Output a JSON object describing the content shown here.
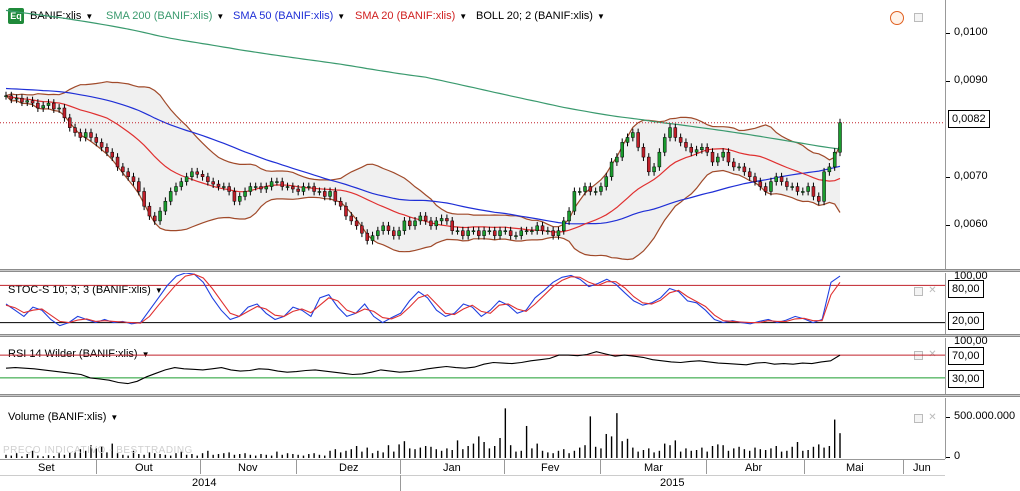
{
  "colors": {
    "price_up": "#1a9c2e",
    "price_down": "#c0202a",
    "sma200": "#3a9a6e",
    "sma50": "#1f2fd6",
    "sma20": "#e03030",
    "boll": "#a04a2a",
    "stoch_k": "#2040e0",
    "stoch_d": "#e03030",
    "level_line": "#c0202a",
    "oversold_line": "#1a9c2e"
  },
  "price_panel": {
    "logo": "Eq",
    "symbol": "BANIF:xlis",
    "sma200": "SMA 200 (BANIF:xlis)",
    "sma50": "SMA 50 (BANIF:xlis)",
    "sma20": "SMA 20 (BANIF:xlis)",
    "boll": "BOLL 20; 2 (BANIF:xlis)",
    "y_ticks": [
      "0,0100",
      "0,0090",
      "0,0070",
      "0,0060"
    ],
    "last_price": "0,0082"
  },
  "stoch_panel": {
    "title": "STOC-S 10; 3; 3 (BANIF:xlis)",
    "y_ticks": [
      "100,00"
    ],
    "levels": [
      "80,00",
      "20,00"
    ]
  },
  "rsi_panel": {
    "title": "RSI 14 Wilder (BANIF:xlis)",
    "y_ticks": [
      "100,00"
    ],
    "levels": [
      "70,00",
      "30,00"
    ]
  },
  "volume_panel": {
    "title": "Volume (BANIF:xlis)",
    "y_ticks": [
      "500.000.000",
      "0"
    ]
  },
  "x_axis": {
    "months": [
      "Set",
      "Out",
      "Nov",
      "Dez",
      "Jan",
      "Fev",
      "Mar",
      "Abr",
      "Mai",
      "Jun"
    ],
    "years": [
      "2014",
      "2015"
    ]
  },
  "watermark": "PREÇO INDICATIVO - BESTTRADING",
  "chart_data": [
    {
      "type": "candlestick",
      "title": "BANIF:xlis",
      "x_range": [
        "2014-09",
        "2015-06"
      ],
      "ylim": [
        0.0052,
        0.0107
      ],
      "close": [
        0.00875,
        0.00868,
        0.0087,
        0.00862,
        0.00865,
        0.0086,
        0.0085,
        0.00855,
        0.0086,
        0.00848,
        0.0085,
        0.0083,
        0.0081,
        0.008,
        0.0079,
        0.008,
        0.0079,
        0.0078,
        0.0077,
        0.0076,
        0.0075,
        0.0073,
        0.0072,
        0.0071,
        0.007,
        0.0068,
        0.0065,
        0.0063,
        0.0062,
        0.0064,
        0.0066,
        0.0068,
        0.0069,
        0.007,
        0.0071,
        0.0072,
        0.00715,
        0.0071,
        0.007,
        0.00695,
        0.0069,
        0.0069,
        0.0068,
        0.0066,
        0.0067,
        0.0068,
        0.0069,
        0.0069,
        0.00685,
        0.0069,
        0.007,
        0.007,
        0.0069,
        0.0069,
        0.00685,
        0.0068,
        0.0069,
        0.0069,
        0.0068,
        0.0068,
        0.0067,
        0.0068,
        0.0066,
        0.0065,
        0.0063,
        0.0062,
        0.0061,
        0.00595,
        0.0058,
        0.0059,
        0.006,
        0.0061,
        0.006,
        0.0059,
        0.006,
        0.0062,
        0.0061,
        0.0062,
        0.0063,
        0.0062,
        0.0061,
        0.0062,
        0.00625,
        0.0062,
        0.006,
        0.006,
        0.0059,
        0.006,
        0.006,
        0.0059,
        0.006,
        0.006,
        0.0059,
        0.006,
        0.006,
        0.0059,
        0.0059,
        0.006,
        0.006,
        0.006,
        0.0061,
        0.006,
        0.006,
        0.0059,
        0.006,
        0.0062,
        0.0064,
        0.0068,
        0.0068,
        0.0069,
        0.0068,
        0.0068,
        0.0069,
        0.0071,
        0.0074,
        0.0075,
        0.0078,
        0.0079,
        0.008,
        0.0077,
        0.0075,
        0.0072,
        0.0073,
        0.0076,
        0.0079,
        0.0081,
        0.0079,
        0.0078,
        0.0077,
        0.0076,
        0.00765,
        0.0077,
        0.0076,
        0.0074,
        0.0075,
        0.0076,
        0.0074,
        0.0073,
        0.0073,
        0.0072,
        0.0071,
        0.007,
        0.0069,
        0.0068,
        0.007,
        0.0071,
        0.007,
        0.0069,
        0.0069,
        0.0068,
        0.0068,
        0.0069,
        0.0067,
        0.0066,
        0.0072,
        0.0073,
        0.0076,
        0.0082
      ],
      "overlays": [
        "SMA 200",
        "SMA 50",
        "SMA 20",
        "BOLL 20; 2"
      ]
    },
    {
      "type": "line",
      "title": "STOC-S 10; 3; 3",
      "ylim": [
        0,
        100
      ],
      "series": [
        {
          "name": "%K",
          "values": [
            50,
            40,
            30,
            45,
            40,
            25,
            15,
            20,
            30,
            25,
            20,
            25,
            20,
            22,
            18,
            20,
            40,
            60,
            80,
            95,
            100,
            98,
            85,
            60,
            40,
            25,
            30,
            45,
            50,
            35,
            25,
            30,
            45,
            40,
            30,
            60,
            65,
            45,
            30,
            35,
            50,
            30,
            20,
            28,
            35,
            55,
            70,
            60,
            40,
            30,
            35,
            50,
            45,
            30,
            40,
            55,
            48,
            35,
            40,
            60,
            72,
            85,
            93,
            96,
            90,
            78,
            83,
            90,
            82,
            68,
            55,
            48,
            52,
            60,
            75,
            70,
            55,
            52,
            40,
            25,
            20,
            23,
            20,
            18,
            22,
            25,
            20,
            24,
            30,
            26,
            20,
            25,
            85,
            95
          ]
        },
        {
          "name": "%D",
          "values": [
            48,
            44,
            36,
            40,
            42,
            32,
            22,
            20,
            24,
            26,
            22,
            23,
            22,
            21,
            20,
            19,
            30,
            48,
            65,
            82,
            95,
            98,
            92,
            75,
            55,
            35,
            30,
            38,
            46,
            42,
            32,
            30,
            38,
            42,
            36,
            48,
            60,
            55,
            40,
            35,
            42,
            38,
            28,
            26,
            32,
            45,
            60,
            65,
            50,
            35,
            33,
            42,
            48,
            38,
            35,
            48,
            50,
            42,
            38,
            50,
            64,
            78,
            88,
            94,
            93,
            85,
            80,
            86,
            86,
            76,
            62,
            52,
            50,
            56,
            68,
            72,
            62,
            54,
            46,
            32,
            23,
            22,
            21,
            20,
            20,
            23,
            22,
            22,
            26,
            27,
            23,
            23,
            65,
            85
          ]
        }
      ],
      "levels": [
        80,
        20
      ]
    },
    {
      "type": "line",
      "title": "RSI 14 Wilder",
      "ylim": [
        0,
        100
      ],
      "series": [
        {
          "name": "RSI",
          "values": [
            47,
            48,
            47,
            46,
            44,
            42,
            40,
            38,
            36,
            30,
            28,
            26,
            22,
            20,
            24,
            32,
            38,
            44,
            48,
            46,
            45,
            44,
            46,
            48,
            44,
            42,
            43,
            46,
            45,
            42,
            40,
            41,
            43,
            44,
            42,
            40,
            38,
            36,
            37,
            40,
            44,
            42,
            40,
            41,
            43,
            46,
            48,
            50,
            48,
            47,
            49,
            54,
            57,
            56,
            55,
            57,
            60,
            62,
            64,
            70,
            70,
            69,
            71,
            76,
            72,
            68,
            70,
            68,
            66,
            62,
            60,
            58,
            57,
            59,
            60,
            58,
            56,
            55,
            54,
            53,
            56,
            57,
            54,
            55,
            54,
            56,
            55,
            58,
            60,
            70
          ]
        }
      ],
      "levels": [
        70,
        30
      ]
    },
    {
      "type": "bar",
      "title": "Volume",
      "ylim": [
        0,
        700000000
      ],
      "values": [
        40,
        30,
        60,
        20,
        50,
        90,
        30,
        20,
        35,
        25,
        60,
        40,
        70,
        80,
        110,
        90,
        160,
        120,
        150,
        70,
        180,
        60,
        40,
        30,
        90,
        50,
        40,
        70,
        60,
        50,
        40,
        30,
        60,
        80,
        40,
        50,
        30,
        60,
        90,
        40,
        50,
        60,
        70,
        40,
        50,
        60,
        40,
        30,
        50,
        40,
        30,
        80,
        40,
        60,
        50,
        40,
        30,
        50,
        60,
        40,
        30,
        90,
        110,
        70,
        90,
        110,
        150,
        80,
        130,
        60,
        90,
        70,
        160,
        80,
        170,
        210,
        120,
        110,
        130,
        150,
        140,
        110,
        90,
        120,
        100,
        220,
        110,
        150,
        180,
        270,
        200,
        120,
        150,
        250,
        620,
        160,
        80,
        90,
        400,
        120,
        180,
        90,
        70,
        60,
        90,
        110,
        60,
        90,
        130,
        160,
        520,
        140,
        120,
        300,
        270,
        560,
        210,
        240,
        130,
        80,
        100,
        120,
        70,
        90,
        180,
        160,
        220,
        80,
        120,
        90,
        100,
        130,
        80,
        150,
        170,
        160,
        90,
        120,
        140,
        110,
        90,
        130,
        110,
        100,
        120,
        150,
        80,
        90,
        140,
        200,
        90,
        100,
        140,
        170,
        130,
        150,
        480,
        310
      ]
    }
  ]
}
